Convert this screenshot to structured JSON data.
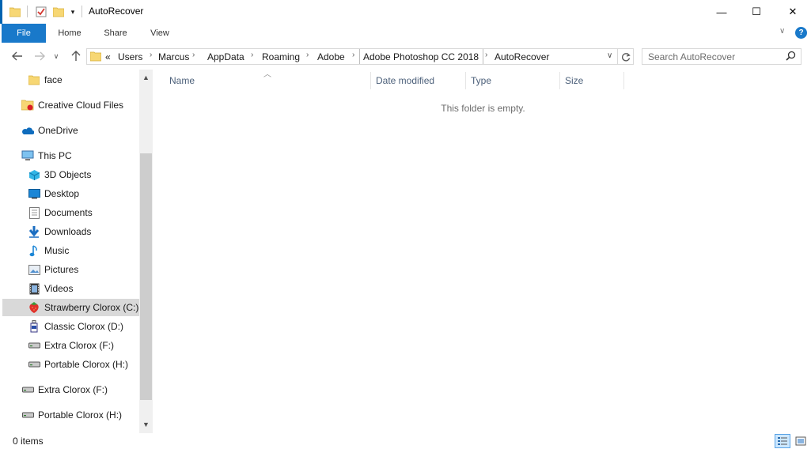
{
  "window": {
    "title": "AutoRecover",
    "controls": {
      "minimize": "—",
      "maximize": "☐",
      "close": "✕"
    }
  },
  "ribbon": {
    "tabs": [
      "File",
      "Home",
      "Share",
      "View"
    ],
    "help": "?"
  },
  "address": {
    "overflow": "«",
    "crumbs": [
      "Users",
      "Marcus",
      "AppData",
      "Roaming",
      "Adobe",
      "Adobe Photoshop CC 2018",
      "AutoRecover"
    ]
  },
  "search": {
    "placeholder": "Search AutoRecover"
  },
  "nav": {
    "items": [
      {
        "label": "face",
        "icon": "folder-icon"
      },
      {
        "label": "Creative Cloud Files",
        "icon": "creative-cloud-folder-icon"
      },
      {
        "label": "OneDrive",
        "icon": "onedrive-icon"
      },
      {
        "label": "This PC",
        "icon": "this-pc-icon"
      },
      {
        "label": "3D Objects",
        "icon": "3d-objects-icon"
      },
      {
        "label": "Desktop",
        "icon": "desktop-icon"
      },
      {
        "label": "Documents",
        "icon": "documents-icon"
      },
      {
        "label": "Downloads",
        "icon": "downloads-icon"
      },
      {
        "label": "Music",
        "icon": "music-icon"
      },
      {
        "label": "Pictures",
        "icon": "pictures-icon"
      },
      {
        "label": "Videos",
        "icon": "videos-icon"
      },
      {
        "label": "Strawberry Clorox (C:)",
        "icon": "strawberry-drive-icon"
      },
      {
        "label": "Classic Clorox (D:)",
        "icon": "bottle-drive-icon"
      },
      {
        "label": "Extra Clorox (F:)",
        "icon": "drive-icon"
      },
      {
        "label": "Portable Clorox (H:)",
        "icon": "drive-icon"
      },
      {
        "label": "Extra Clorox (F:)",
        "icon": "drive-icon"
      },
      {
        "label": "Portable Clorox (H:)",
        "icon": "drive-icon"
      }
    ]
  },
  "columns": [
    "Name",
    "Date modified",
    "Type",
    "Size"
  ],
  "empty_message": "This folder is empty.",
  "status": {
    "items": "0 items"
  },
  "colors": {
    "accent": "#1979ca",
    "selected": "#cde8ff",
    "nav_selected": "#d9d9d9"
  }
}
